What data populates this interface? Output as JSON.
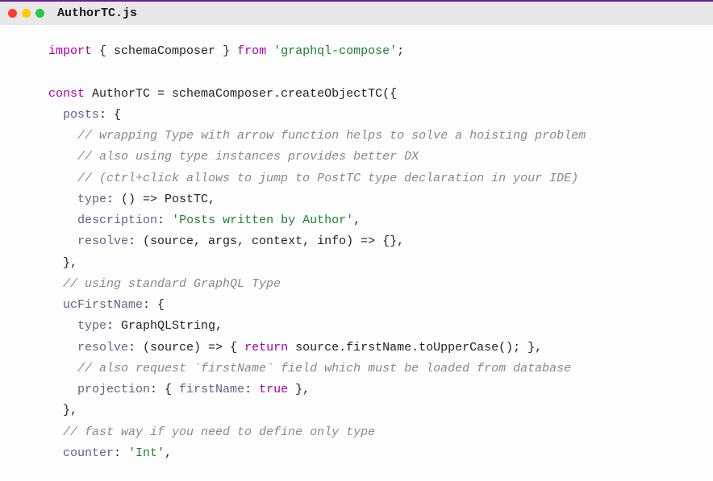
{
  "title": "AuthorTC.js",
  "code": {
    "l1_import": "import",
    "l1_brace_open": " { ",
    "l1_ident": "schemaComposer",
    "l1_brace_close": " } ",
    "l1_from": "from",
    "l1_sp": " ",
    "l1_str": "'graphql-compose'",
    "l1_semi": ";",
    "l3_const": "const",
    "l3_rest": " AuthorTC = schemaComposer.createObjectTC({",
    "l4_indent": "  ",
    "l4_key": "posts",
    "l4_rest": ": {",
    "l5_indent": "    ",
    "l5_cmt": "// wrapping Type with arrow function helps to solve a hoisting problem",
    "l6_indent": "    ",
    "l6_cmt": "// also using type instances provides better DX",
    "l7_indent": "    ",
    "l7_cmt": "// (ctrl+click allows to jump to PostTC type declaration in your IDE)",
    "l8_indent": "    ",
    "l8_key": "type",
    "l8_rest": ": () => PostTC,",
    "l9_indent": "    ",
    "l9_key": "description",
    "l9_colon": ": ",
    "l9_str": "'Posts written by Author'",
    "l9_comma": ",",
    "l10_indent": "    ",
    "l10_key": "resolve",
    "l10_rest": ": (source, args, context, info) => {},",
    "l11_indent": "  ",
    "l11_rest": "},",
    "l12_indent": "  ",
    "l12_cmt": "// using standard GraphQL Type",
    "l13_indent": "  ",
    "l13_key": "ucFirstName",
    "l13_rest": ": {",
    "l14_indent": "    ",
    "l14_key": "type",
    "l14_rest": ": GraphQLString,",
    "l15_indent": "    ",
    "l15_key": "resolve",
    "l15_mid": ": (source) => { ",
    "l15_return": "return",
    "l15_rest": " source.firstName.toUpperCase(); },",
    "l16_indent": "    ",
    "l16_cmt": "// also request `firstName` field which must be loaded from database",
    "l17_indent": "    ",
    "l17_key": "projection",
    "l17_mid": ": { ",
    "l17_key2": "firstName",
    "l17_colon": ": ",
    "l17_true": "true",
    "l17_rest": " },",
    "l18_indent": "  ",
    "l18_rest": "},",
    "l19_indent": "  ",
    "l19_cmt": "// fast way if you need to define only type",
    "l20_indent": "  ",
    "l20_key": "counter",
    "l20_colon": ": ",
    "l20_str": "'Int'",
    "l20_comma": ","
  }
}
